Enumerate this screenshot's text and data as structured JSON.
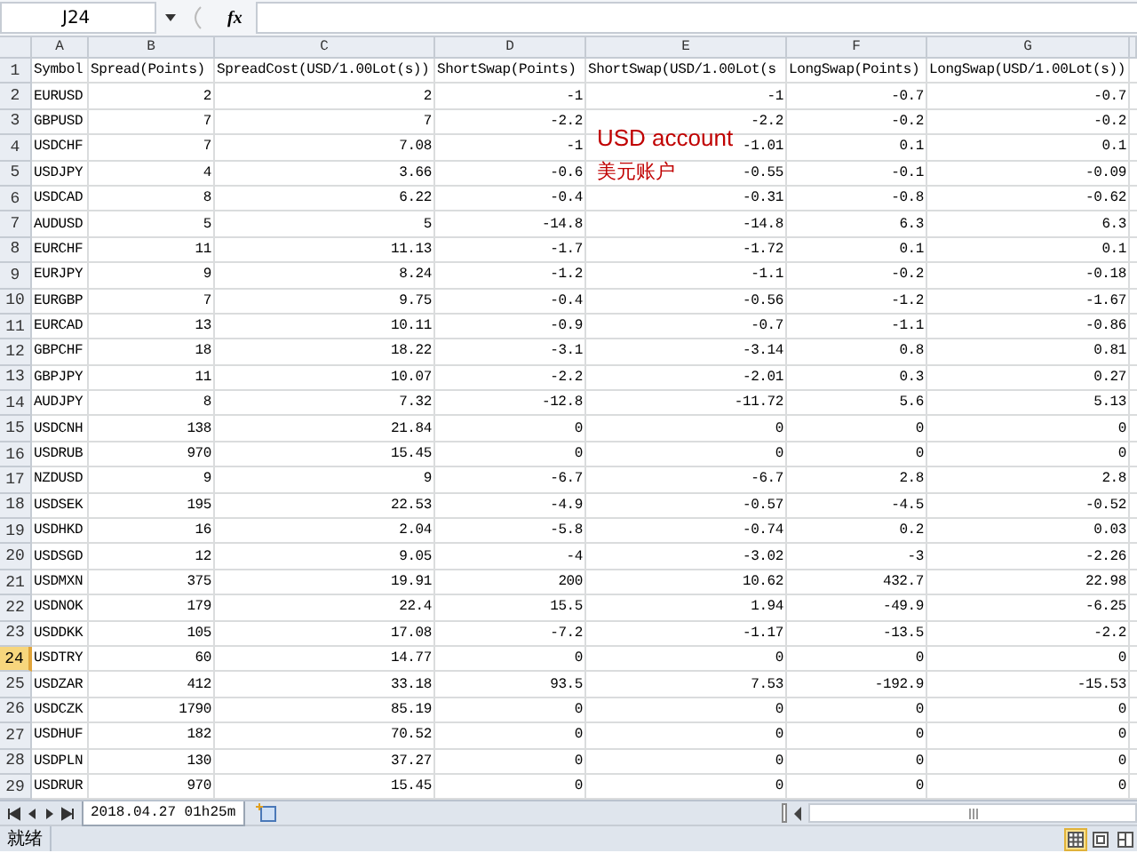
{
  "name_box": "J24",
  "function_label": "fx",
  "columns": [
    "A",
    "B",
    "C",
    "D",
    "E",
    "F",
    "G"
  ],
  "rows": [
    {
      "number": "1",
      "selected": false,
      "cells": [
        "Symbol",
        "Spread(Points)",
        "SpreadCost(USD/1.00Lot(s))",
        "ShortSwap(Points)",
        "ShortSwap(USD/1.00Lot(s",
        "LongSwap(Points)",
        "LongSwap(USD/1.00Lot(s))"
      ]
    },
    {
      "number": "2",
      "selected": false,
      "cells": [
        "EURUSD",
        "2",
        "2",
        "-1",
        "-1",
        "-0.7",
        "-0.7"
      ]
    },
    {
      "number": "3",
      "selected": false,
      "cells": [
        "GBPUSD",
        "7",
        "7",
        "-2.2",
        "-2.2",
        "-0.2",
        "-0.2"
      ]
    },
    {
      "number": "4",
      "selected": false,
      "cells": [
        "USDCHF",
        "7",
        "7.08",
        "-1",
        "-1.01",
        "0.1",
        "0.1"
      ]
    },
    {
      "number": "5",
      "selected": false,
      "cells": [
        "USDJPY",
        "4",
        "3.66",
        "-0.6",
        "-0.55",
        "-0.1",
        "-0.09"
      ]
    },
    {
      "number": "6",
      "selected": false,
      "cells": [
        "USDCAD",
        "8",
        "6.22",
        "-0.4",
        "-0.31",
        "-0.8",
        "-0.62"
      ]
    },
    {
      "number": "7",
      "selected": false,
      "cells": [
        "AUDUSD",
        "5",
        "5",
        "-14.8",
        "-14.8",
        "6.3",
        "6.3"
      ]
    },
    {
      "number": "8",
      "selected": false,
      "cells": [
        "EURCHF",
        "11",
        "11.13",
        "-1.7",
        "-1.72",
        "0.1",
        "0.1"
      ]
    },
    {
      "number": "9",
      "selected": false,
      "cells": [
        "EURJPY",
        "9",
        "8.24",
        "-1.2",
        "-1.1",
        "-0.2",
        "-0.18"
      ]
    },
    {
      "number": "10",
      "selected": false,
      "cells": [
        "EURGBP",
        "7",
        "9.75",
        "-0.4",
        "-0.56",
        "-1.2",
        "-1.67"
      ]
    },
    {
      "number": "11",
      "selected": false,
      "cells": [
        "EURCAD",
        "13",
        "10.11",
        "-0.9",
        "-0.7",
        "-1.1",
        "-0.86"
      ]
    },
    {
      "number": "12",
      "selected": false,
      "cells": [
        "GBPCHF",
        "18",
        "18.22",
        "-3.1",
        "-3.14",
        "0.8",
        "0.81"
      ]
    },
    {
      "number": "13",
      "selected": false,
      "cells": [
        "GBPJPY",
        "11",
        "10.07",
        "-2.2",
        "-2.01",
        "0.3",
        "0.27"
      ]
    },
    {
      "number": "14",
      "selected": false,
      "cells": [
        "AUDJPY",
        "8",
        "7.32",
        "-12.8",
        "-11.72",
        "5.6",
        "5.13"
      ]
    },
    {
      "number": "15",
      "selected": false,
      "cells": [
        "USDCNH",
        "138",
        "21.84",
        "0",
        "0",
        "0",
        "0"
      ]
    },
    {
      "number": "16",
      "selected": false,
      "cells": [
        "USDRUB",
        "970",
        "15.45",
        "0",
        "0",
        "0",
        "0"
      ]
    },
    {
      "number": "17",
      "selected": false,
      "cells": [
        "NZDUSD",
        "9",
        "9",
        "-6.7",
        "-6.7",
        "2.8",
        "2.8"
      ]
    },
    {
      "number": "18",
      "selected": false,
      "cells": [
        "USDSEK",
        "195",
        "22.53",
        "-4.9",
        "-0.57",
        "-4.5",
        "-0.52"
      ]
    },
    {
      "number": "19",
      "selected": false,
      "cells": [
        "USDHKD",
        "16",
        "2.04",
        "-5.8",
        "-0.74",
        "0.2",
        "0.03"
      ]
    },
    {
      "number": "20",
      "selected": false,
      "cells": [
        "USDSGD",
        "12",
        "9.05",
        "-4",
        "-3.02",
        "-3",
        "-2.26"
      ]
    },
    {
      "number": "21",
      "selected": false,
      "cells": [
        "USDMXN",
        "375",
        "19.91",
        "200",
        "10.62",
        "432.7",
        "22.98"
      ]
    },
    {
      "number": "22",
      "selected": false,
      "cells": [
        "USDNOK",
        "179",
        "22.4",
        "15.5",
        "1.94",
        "-49.9",
        "-6.25"
      ]
    },
    {
      "number": "23",
      "selected": false,
      "cells": [
        "USDDKK",
        "105",
        "17.08",
        "-7.2",
        "-1.17",
        "-13.5",
        "-2.2"
      ]
    },
    {
      "number": "24",
      "selected": true,
      "cells": [
        "USDTRY",
        "60",
        "14.77",
        "0",
        "0",
        "0",
        "0"
      ]
    },
    {
      "number": "25",
      "selected": false,
      "cells": [
        "USDZAR",
        "412",
        "33.18",
        "93.5",
        "7.53",
        "-192.9",
        "-15.53"
      ]
    },
    {
      "number": "26",
      "selected": false,
      "cells": [
        "USDCZK",
        "1790",
        "85.19",
        "0",
        "0",
        "0",
        "0"
      ]
    },
    {
      "number": "27",
      "selected": false,
      "cells": [
        "USDHUF",
        "182",
        "70.52",
        "0",
        "0",
        "0",
        "0"
      ]
    },
    {
      "number": "28",
      "selected": false,
      "cells": [
        "USDPLN",
        "130",
        "37.27",
        "0",
        "0",
        "0",
        "0"
      ]
    },
    {
      "number": "29",
      "selected": false,
      "cells": [
        "USDRUR",
        "970",
        "15.45",
        "0",
        "0",
        "0",
        "0"
      ]
    }
  ],
  "note": {
    "lines": [
      "USD account",
      "美元账户"
    ],
    "color": "#c00000"
  },
  "sheet_tabs": [
    {
      "label": "2018.04.27 01h25m",
      "selected": true
    }
  ],
  "status_bar": {
    "text": "就绪"
  },
  "view_buttons": [
    {
      "kind": "normal",
      "selected": true
    },
    {
      "kind": "page_layout",
      "selected": false
    },
    {
      "kind": "page_break",
      "selected": false
    }
  ]
}
